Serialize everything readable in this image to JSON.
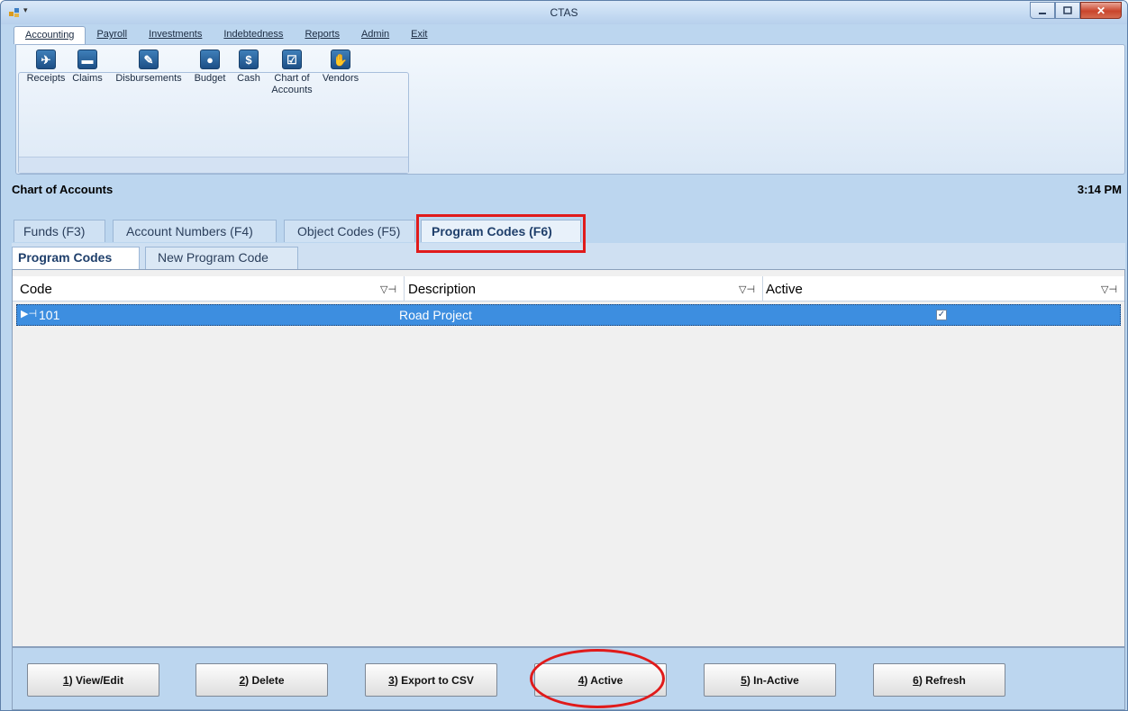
{
  "window": {
    "title": "CTAS"
  },
  "menu": [
    {
      "label": "Accounting",
      "active": true
    },
    {
      "label": "Payroll"
    },
    {
      "label": "Investments"
    },
    {
      "label": "Indebtedness"
    },
    {
      "label": "Reports"
    },
    {
      "label": "Admin"
    },
    {
      "label": "Exit"
    }
  ],
  "ribbon": {
    "buttons": [
      {
        "label": "Receipts",
        "icon": "receipts-icon"
      },
      {
        "label": "Claims",
        "icon": "claims-icon"
      },
      {
        "label": "Disbursements",
        "icon": "disbursements-icon"
      },
      {
        "label": "Budget",
        "icon": "piggy-bank-icon"
      },
      {
        "label": "Cash",
        "icon": "cash-icon"
      },
      {
        "label": "Chart of\nAccounts",
        "label_line1": "Chart of",
        "label_line2": "Accounts",
        "icon": "chart-of-accounts-icon"
      },
      {
        "label": "Vendors",
        "icon": "handshake-icon"
      }
    ]
  },
  "section": {
    "title": "Chart of Accounts",
    "time": "3:14 PM"
  },
  "tabs": [
    {
      "label": "Funds (F3)"
    },
    {
      "label": "Account Numbers (F4)"
    },
    {
      "label": "Object Codes (F5)"
    },
    {
      "label": "Program Codes (F6)",
      "active": true
    }
  ],
  "subtabs": [
    {
      "label": "Program Codes",
      "active": true
    },
    {
      "label": "New Program Code"
    }
  ],
  "grid": {
    "columns": [
      "Code",
      "Description",
      "Active"
    ],
    "rows": [
      {
        "code": "101",
        "description": "Road Project",
        "active": true
      }
    ]
  },
  "actions": [
    {
      "key": "1",
      "label": ") View/Edit"
    },
    {
      "key": "2",
      "label": ") Delete"
    },
    {
      "key": "3",
      "label": ") Export to CSV"
    },
    {
      "key": "4",
      "label": ") Active"
    },
    {
      "key": "5",
      "label": ") In-Active"
    },
    {
      "key": "6",
      "label": ") Refresh"
    }
  ],
  "colors": {
    "accent": "#3d8ee0",
    "highlight": "#e01b1b",
    "chrome": "#bcd6ef"
  }
}
